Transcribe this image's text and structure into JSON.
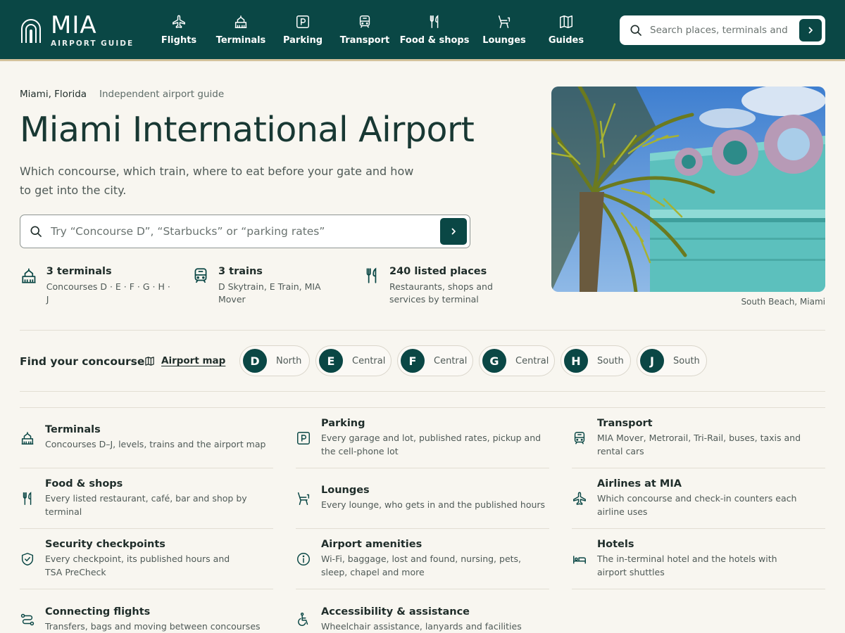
{
  "brand": {
    "name": "MIA",
    "subtitle": "AIRPORT GUIDE"
  },
  "nav": [
    {
      "label": "Flights",
      "icon": "plane-icon"
    },
    {
      "label": "Terminals",
      "icon": "terminal-building-icon"
    },
    {
      "label": "Parking",
      "icon": "parking-icon"
    },
    {
      "label": "Transport",
      "icon": "train-icon"
    },
    {
      "label": "Food & shops",
      "icon": "fork-knife-icon"
    },
    {
      "label": "Lounges",
      "icon": "lounge-chair-icon"
    },
    {
      "label": "Guides",
      "icon": "map-icon"
    }
  ],
  "header_search": {
    "placeholder": "Search places, terminals and gates"
  },
  "hero": {
    "location": "Miami, Florida",
    "tagline": "Independent airport guide",
    "title": "Miami International Airport",
    "description": "Which concourse, which train, where to eat before your gate and how to get into the city.",
    "search_placeholder": "Try “Concourse D”, “Starbucks” or “parking rates”",
    "photo_caption": "South Beach, Miami"
  },
  "stats": [
    {
      "title": "3 terminals",
      "sub": "Concourses D · E · F · G · H · J",
      "icon": "terminal-building-icon"
    },
    {
      "title": "3 trains",
      "sub": "D Skytrain, E Train, MIA Mover",
      "icon": "train-icon"
    },
    {
      "title": "240 listed places",
      "sub": "Restaurants, shops and services by terminal",
      "icon": "fork-knife-icon"
    }
  ],
  "concourse": {
    "label": "Find your concourse",
    "map_link": "Airport map",
    "items": [
      {
        "letter": "D",
        "zone": "North"
      },
      {
        "letter": "E",
        "zone": "Central"
      },
      {
        "letter": "F",
        "zone": "Central"
      },
      {
        "letter": "G",
        "zone": "Central"
      },
      {
        "letter": "H",
        "zone": "South"
      },
      {
        "letter": "J",
        "zone": "South"
      }
    ]
  },
  "categories": [
    {
      "title": "Terminals",
      "desc": "Concourses D–J, levels, trains and the airport map",
      "icon": "terminal-building-icon"
    },
    {
      "title": "Parking",
      "desc": "Every garage and lot, published rates, pickup and the cell-phone lot",
      "icon": "parking-icon"
    },
    {
      "title": "Transport",
      "desc": "MIA Mover, Metrorail, Tri-Rail, buses, taxis and rental cars",
      "icon": "train-icon"
    },
    {
      "title": "Food & shops",
      "desc": "Every listed restaurant, café, bar and shop by terminal",
      "icon": "fork-knife-icon"
    },
    {
      "title": "Lounges",
      "desc": "Every lounge, who gets in and the published hours",
      "icon": "lounge-chair-icon"
    },
    {
      "title": "Airlines at MIA",
      "desc": "Which concourse and check-in counters each airline uses",
      "icon": "plane-icon"
    },
    {
      "title": "Security checkpoints",
      "desc": "Every checkpoint, its published hours and TSA PreCheck",
      "icon": "shield-check-icon"
    },
    {
      "title": "Airport amenities",
      "desc": "Wi-Fi, baggage, lost and found, nursing, pets, sleep, chapel and more",
      "icon": "info-icon"
    },
    {
      "title": "Hotels",
      "desc": "The in-terminal hotel and the hotels with airport shuttles",
      "icon": "bed-icon"
    },
    {
      "title": "Connecting flights",
      "desc": "Transfers, bags and moving between concourses",
      "icon": "route-icon"
    },
    {
      "title": "Accessibility & assistance",
      "desc": "Wheelchair assistance, lanyards and facilities",
      "icon": "wheelchair-icon"
    }
  ],
  "colors": {
    "primary": "#0a4745",
    "background": "#f8f6f0",
    "accent_rule": "#d3c29b",
    "text": "#1f2d2a",
    "muted": "#4f5a57"
  }
}
